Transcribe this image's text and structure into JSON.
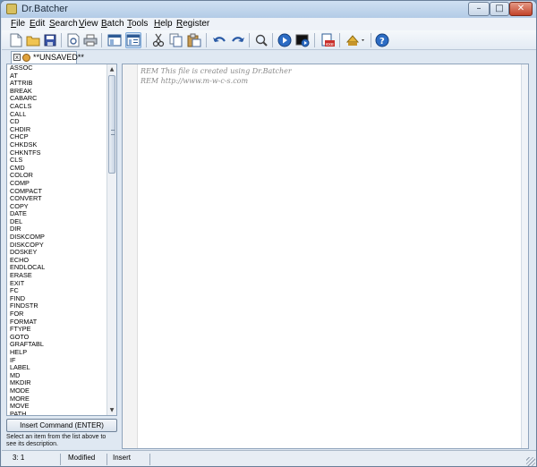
{
  "window": {
    "title": "Dr.Batcher"
  },
  "titlebar_buttons": {
    "minimize": "–",
    "maximize": "□",
    "close": "✕"
  },
  "menu": [
    "File",
    "Edit",
    "Search",
    "View",
    "Batch",
    "Tools",
    "Help",
    "Register"
  ],
  "toolbar_icons": [
    "new-file-icon",
    "open-folder-icon",
    "save-icon",
    "print-preview-icon",
    "print-icon",
    "view-normal-icon",
    "view-split-icon",
    "cut-icon",
    "copy-icon",
    "paste-icon",
    "undo-icon",
    "redo-icon",
    "find-icon",
    "run-icon",
    "run-console-icon",
    "convert-exe-icon",
    "batch-tools-icon",
    "help-icon"
  ],
  "tab": {
    "label": "**UNSAVED**",
    "close": "x"
  },
  "commands": [
    "ASSOC",
    "AT",
    "ATTRIB",
    "BREAK",
    "CABARC",
    "CACLS",
    "CALL",
    "CD",
    "CHDIR",
    "CHCP",
    "CHKDSK",
    "CHKNTFS",
    "CLS",
    "CMD",
    "COLOR",
    "COMP",
    "COMPACT",
    "CONVERT",
    "COPY",
    "DATE",
    "DEL",
    "DIR",
    "DISKCOMP",
    "DISKCOPY",
    "DOSKEY",
    "ECHO",
    "ENDLOCAL",
    "ERASE",
    "EXIT",
    "FC",
    "FIND",
    "FINDSTR",
    "FOR",
    "FORMAT",
    "FTYPE",
    "GOTO",
    "GRAFTABL",
    "HELP",
    "IF",
    "LABEL",
    "MD",
    "MKDIR",
    "MODE",
    "MORE",
    "MOVE",
    "PATH"
  ],
  "insert_button": "Insert Command (ENTER)",
  "description": "Select an item from the list above to see its description.",
  "editor_lines": [
    "REM This file is created using Dr.Batcher",
    "REM http://www.m-w-c-s.com"
  ],
  "status": {
    "position": "3: 1",
    "state": "Modified",
    "mode": "Insert"
  },
  "colors": {
    "accent": "#2f6fb5",
    "code_comment": "#8a8a8a"
  }
}
